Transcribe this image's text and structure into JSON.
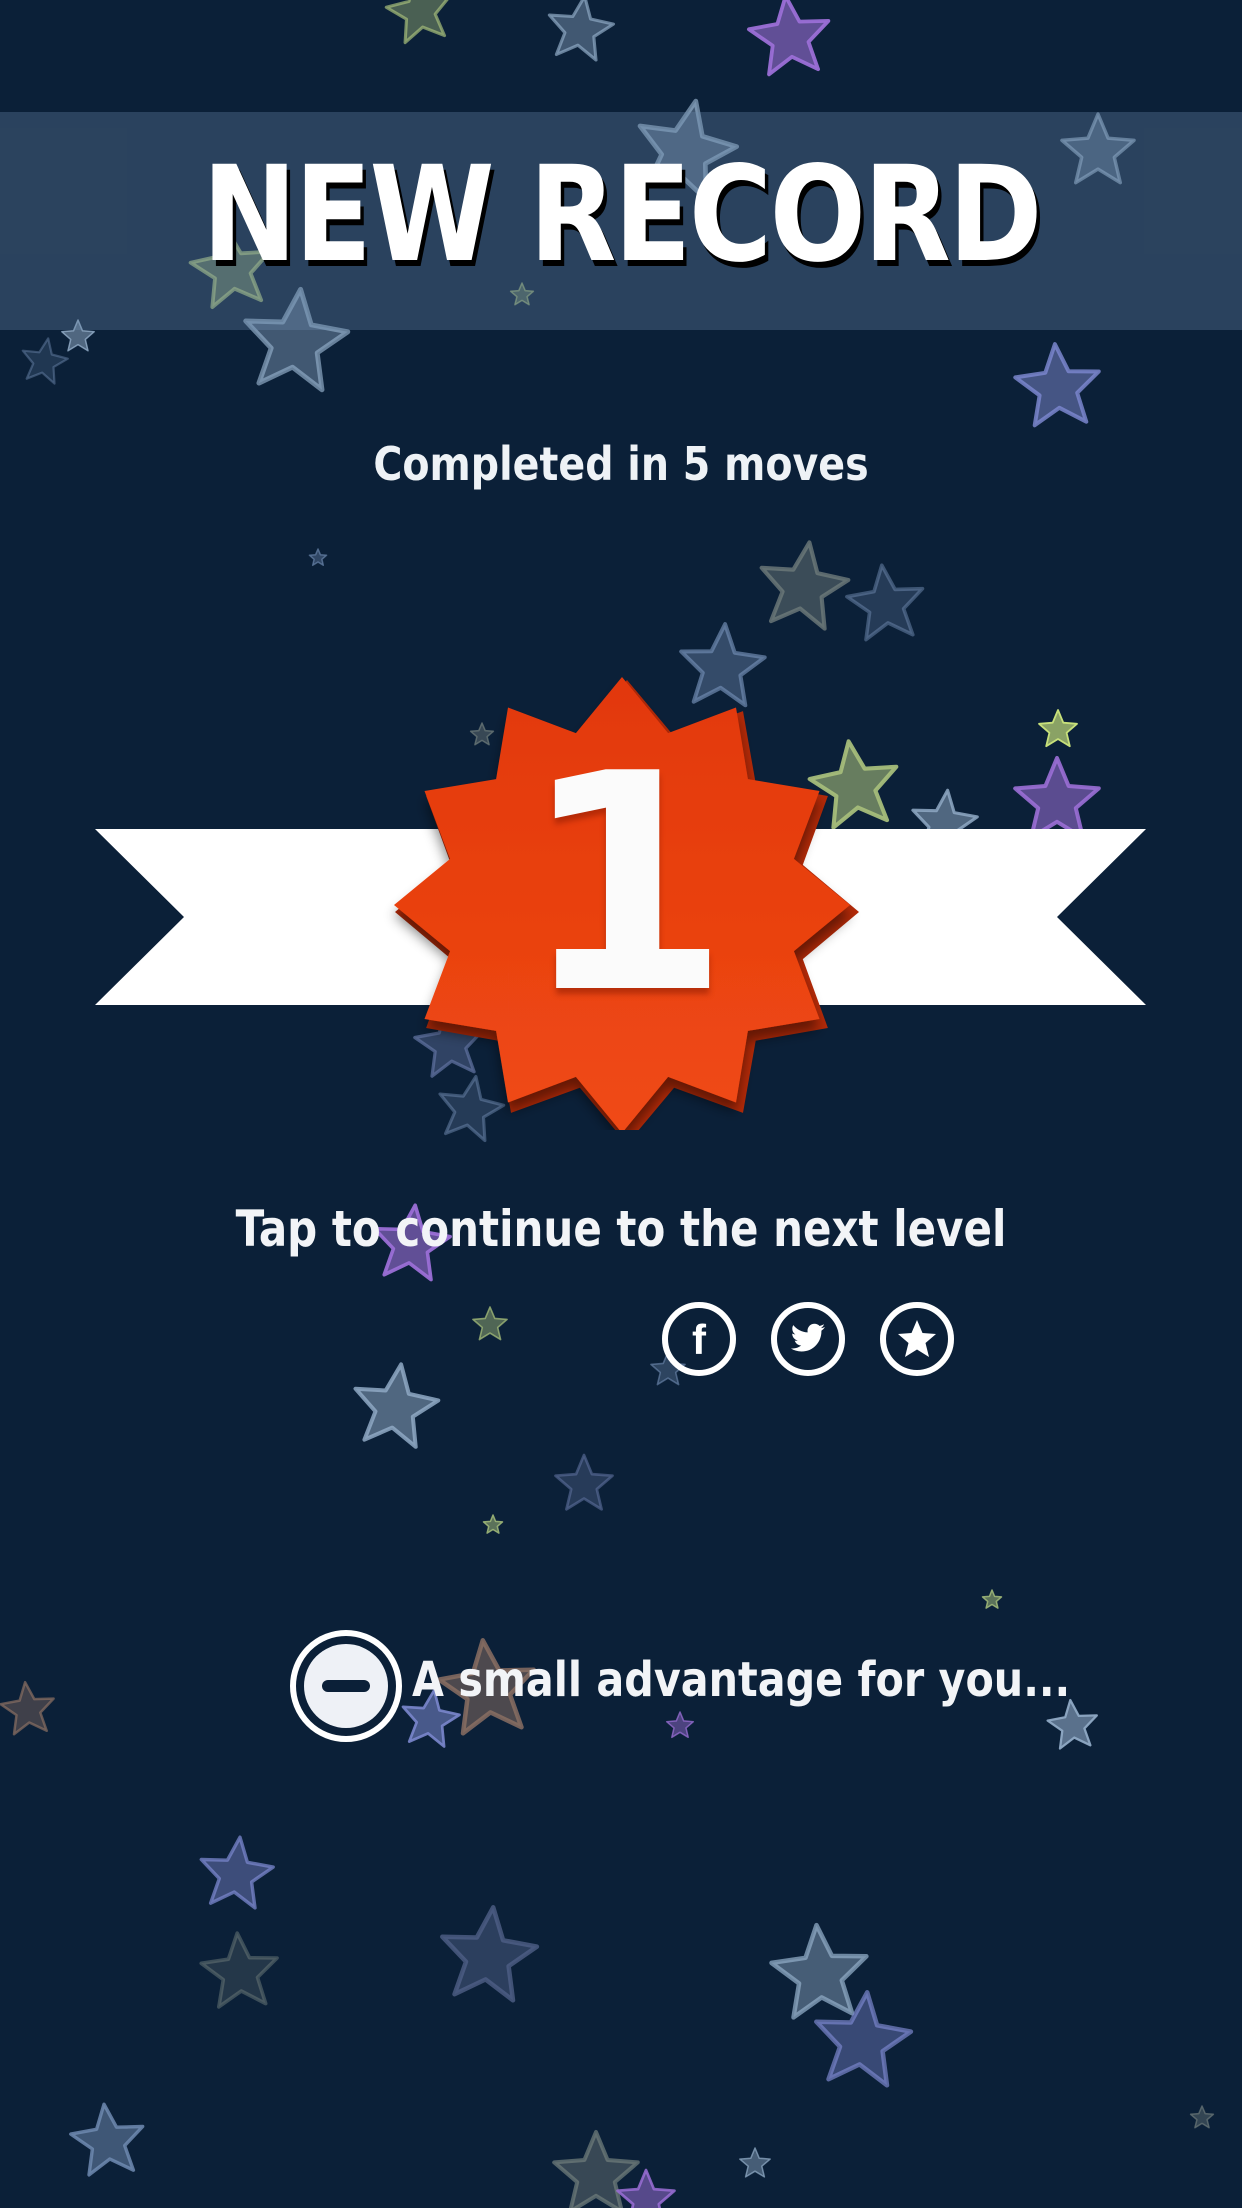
{
  "title": "NEW RECORD",
  "subtitle": "Completed in 5 moves",
  "rank": "1",
  "continue_text": "Tap to continue to the next level",
  "share_buttons": [
    {
      "icon": "facebook-icon",
      "glyph": "f"
    },
    {
      "icon": "twitter-icon",
      "glyph": "bird"
    },
    {
      "icon": "star-rate-icon",
      "glyph": "star"
    }
  ],
  "advantage": {
    "icon": "minus-circle-icon",
    "label": "A small advantage for you..."
  },
  "colors": {
    "background": "#0b2038",
    "title_band": "#3b5470",
    "ribbon": "#ffffff",
    "badge_top": "#e2380c",
    "badge_bottom": "#f04a14",
    "badge_shade": "#b42a08",
    "text": "#ffffff"
  },
  "decoration": {
    "type": "floating-stars",
    "star_colors": [
      "#8fa9c4",
      "#a5bd7a",
      "#9b6fd6",
      "#6f8ab0",
      "#5e6f9c",
      "#7a86cc",
      "#6e7b7a",
      "#c7e07a",
      "#8a6f63",
      "#4f5f86"
    ]
  }
}
